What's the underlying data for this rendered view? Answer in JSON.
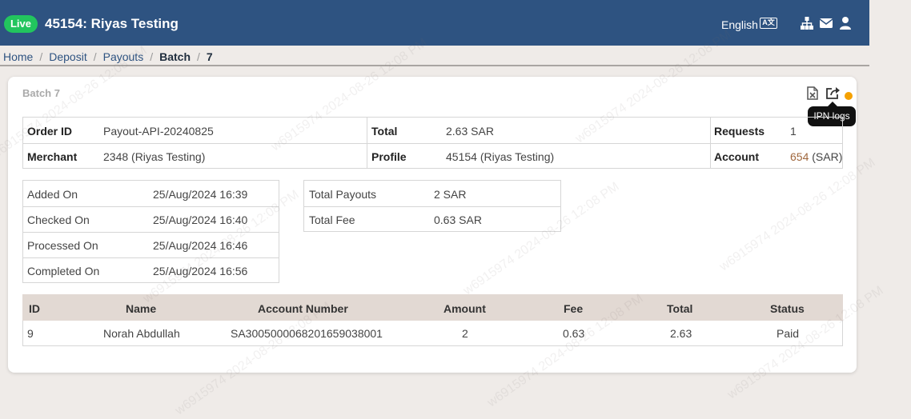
{
  "header": {
    "live_badge": "Live",
    "title": "45154: Riyas Testing",
    "language": "English",
    "language_icon": "translate-icon",
    "icons": [
      "sitemap-icon",
      "envelope-icon",
      "user-icon"
    ]
  },
  "breadcrumb": {
    "home": "Home",
    "deposit": "Deposit",
    "payouts": "Payouts",
    "batch": "Batch",
    "id": "7",
    "sep": "/"
  },
  "card": {
    "title": "Batch 7",
    "tooltip": "IPN logs"
  },
  "summary": {
    "order_id_label": "Order ID",
    "order_id": "Payout-API-20240825",
    "total_label": "Total",
    "total": "2.63 SAR",
    "requests_label": "Requests",
    "requests": "1",
    "merchant_label": "Merchant",
    "merchant": "2348 (Riyas Testing)",
    "profile_label": "Profile",
    "profile": "45154 (Riyas Testing)",
    "account_label": "Account",
    "account_id": "654",
    "account_currency": "(SAR)"
  },
  "dates": [
    {
      "label": "Added On",
      "value": "25/Aug/2024 16:39"
    },
    {
      "label": "Checked On",
      "value": "25/Aug/2024 16:40"
    },
    {
      "label": "Processed On",
      "value": "25/Aug/2024 16:46"
    },
    {
      "label": "Completed On",
      "value": "25/Aug/2024 16:56"
    }
  ],
  "totals": [
    {
      "label": "Total Payouts",
      "value": "2 SAR"
    },
    {
      "label": "Total Fee",
      "value": "0.63 SAR"
    }
  ],
  "table": {
    "headers": [
      "ID",
      "Name",
      "Account Number",
      "Amount",
      "Fee",
      "Total",
      "Status"
    ],
    "rows": [
      [
        "9",
        "Norah Abdullah",
        "SA3005000068201659038001",
        "2",
        "0.63",
        "2.63",
        "Paid"
      ]
    ]
  },
  "watermark": "w6915974 2024-08-26 12:08 PM",
  "colors": {
    "topbar": "#2e5381",
    "live": "#22c55e",
    "link": "#a0673d",
    "status_dot": "#f5a100"
  }
}
